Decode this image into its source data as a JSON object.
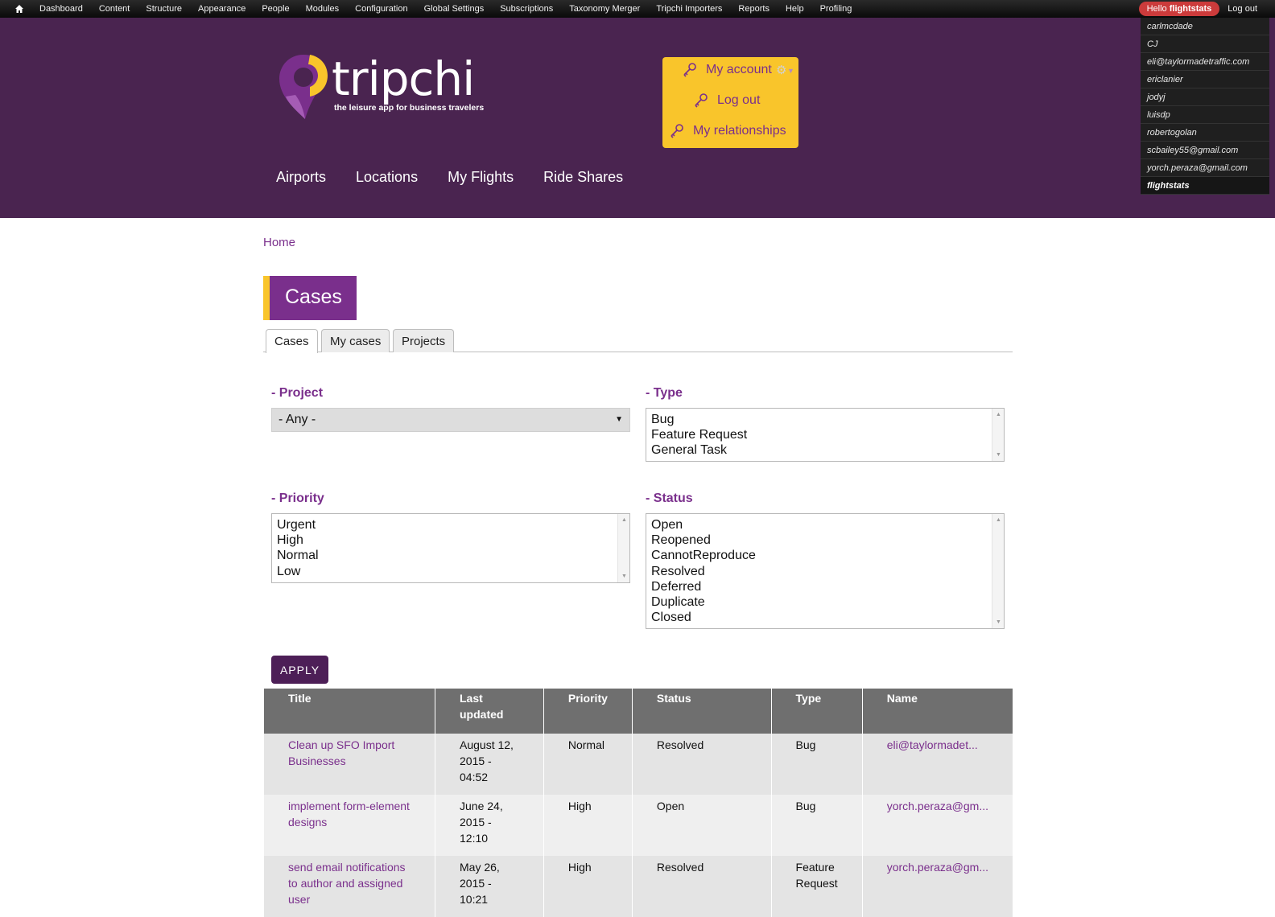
{
  "admin_toolbar": {
    "items": [
      "Dashboard",
      "Content",
      "Structure",
      "Appearance",
      "People",
      "Modules",
      "Configuration",
      "Global Settings",
      "Subscriptions",
      "Taxonomy Merger",
      "Tripchi Importers",
      "Reports",
      "Help",
      "Profiling"
    ],
    "hello_prefix": "Hello",
    "hello_user": "flightstats",
    "logout": "Log out"
  },
  "masquerade_users": [
    "carlmcdade",
    "CJ",
    "eli@taylormadetraffic.com",
    "ericlanier",
    "jodyj",
    "luisdp",
    "robertogolan",
    "scbailey55@gmail.com",
    "yorch.peraza@gmail.com",
    "flightstats"
  ],
  "logo": {
    "name": "tripchi",
    "tagline": "the leisure app for business travelers"
  },
  "user_menu": {
    "my_account": "My account",
    "log_out": "Log out",
    "my_relationships": "My relationships"
  },
  "main_nav": [
    "Airports",
    "Locations",
    "My Flights",
    "Ride Shares"
  ],
  "breadcrumb": "Home",
  "page_title": "Cases",
  "tabs": [
    "Cases",
    "My cases",
    "Projects"
  ],
  "filters": {
    "project": {
      "label": "- Project",
      "value": "- Any -"
    },
    "type": {
      "label": "- Type",
      "options": [
        "Bug",
        "Feature Request",
        "General Task"
      ]
    },
    "priority": {
      "label": "- Priority",
      "options": [
        "Urgent",
        "High",
        "Normal",
        "Low"
      ]
    },
    "status": {
      "label": "- Status",
      "options": [
        "Open",
        "Reopened",
        "CannotReproduce",
        "Resolved",
        "Deferred",
        "Duplicate",
        "Closed"
      ]
    },
    "apply": "APPLY"
  },
  "table": {
    "headers": [
      "Title",
      "Last updated",
      "Priority",
      "Status",
      "Type",
      "Name"
    ],
    "rows": [
      {
        "title": "Clean up SFO Import Businesses",
        "updated": "August 12, 2015 - 04:52",
        "priority": "Normal",
        "status": "Resolved",
        "type": "Bug",
        "name": "eli@taylormadet..."
      },
      {
        "title": "implement form-element designs",
        "updated": "June 24, 2015 - 12:10",
        "priority": "High",
        "status": "Open",
        "type": "Bug",
        "name": "yorch.peraza@gm..."
      },
      {
        "title": "send email notifications to author and assigned user",
        "updated": "May 26, 2015 - 10:21",
        "priority": "High",
        "status": "Resolved",
        "type": "Feature Request",
        "name": "yorch.peraza@gm..."
      }
    ]
  },
  "colors": {
    "header_bg": "#4a2450",
    "accent_purple": "#7a2f8c",
    "accent_yellow": "#f9c52b",
    "apply_bg": "#4d1f57",
    "table_header_bg": "#6f6f6f"
  }
}
